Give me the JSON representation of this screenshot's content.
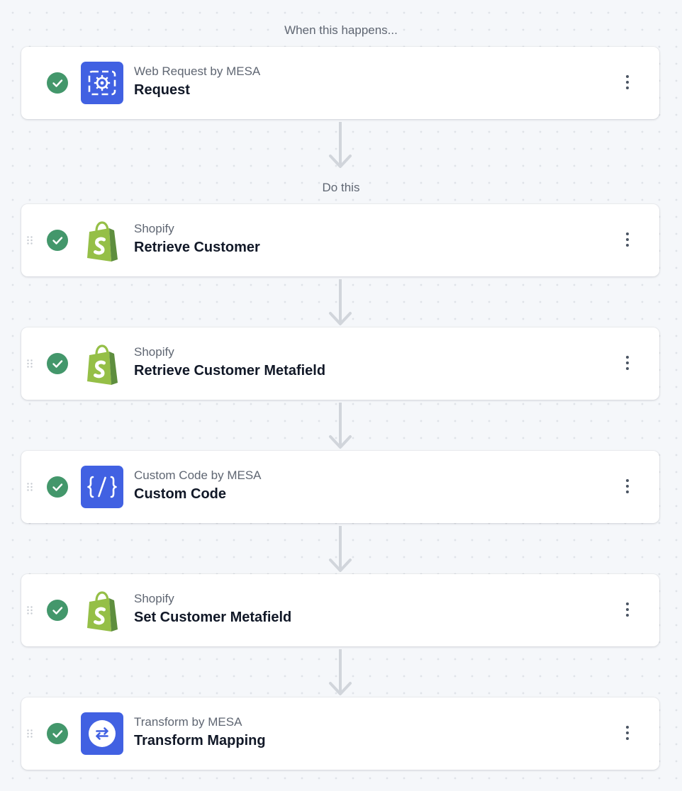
{
  "workflow": {
    "trigger_label": "When this happens...",
    "actions_label": "Do this",
    "trigger": {
      "app": "Web Request by MESA",
      "title": "Request",
      "icon": "web-request-icon",
      "status": "complete"
    },
    "steps": [
      {
        "app": "Shopify",
        "title": "Retrieve Customer",
        "icon": "shopify-icon",
        "status": "complete"
      },
      {
        "app": "Shopify",
        "title": "Retrieve Customer Metafield",
        "icon": "shopify-icon",
        "status": "complete"
      },
      {
        "app": "Custom Code by MESA",
        "title": "Custom Code",
        "icon": "custom-code-icon",
        "status": "complete"
      },
      {
        "app": "Shopify",
        "title": "Set Customer Metafield",
        "icon": "shopify-icon",
        "status": "complete"
      },
      {
        "app": "Transform by MESA",
        "title": "Transform Mapping",
        "icon": "transform-icon",
        "status": "complete"
      }
    ]
  },
  "colors": {
    "canvas_background": "#f5f7fa",
    "status_complete": "#43976b",
    "mesa_blue": "#4161e2",
    "shopify_green": "#95bf47",
    "shopify_dark_green": "#5e8e3e",
    "connector": "#d1d5db"
  }
}
